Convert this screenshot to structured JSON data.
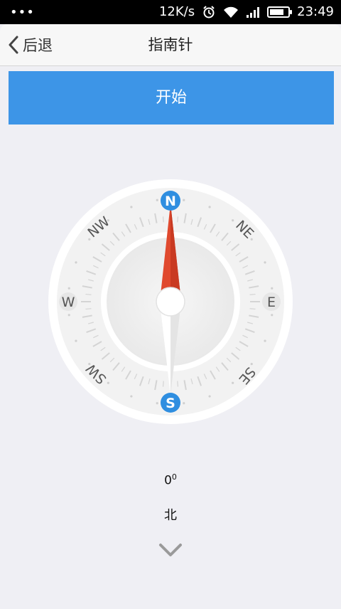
{
  "status_bar": {
    "left_icons": "•••",
    "network_speed": "12K/s",
    "time": "23:49",
    "battery_level": 0.85,
    "icons": [
      "alarm-icon",
      "wifi-icon",
      "signal-icon",
      "battery-icon"
    ]
  },
  "nav": {
    "back_label": "后退",
    "title": "指南针"
  },
  "start_button": {
    "label": "开始",
    "color": "#3d95e7"
  },
  "compass": {
    "cardinals": {
      "N": "N",
      "S": "S",
      "E": "E",
      "W": "W"
    },
    "intercardinals": {
      "NE": "NE",
      "NW": "NW",
      "SE": "SE",
      "SW": "SW"
    },
    "heading_degrees": 0,
    "needle_color": "#e0492e",
    "marker_color": "#2f8ee0"
  },
  "reading": {
    "degree_value": "0",
    "degree_unit": "0",
    "direction_label": "北"
  }
}
